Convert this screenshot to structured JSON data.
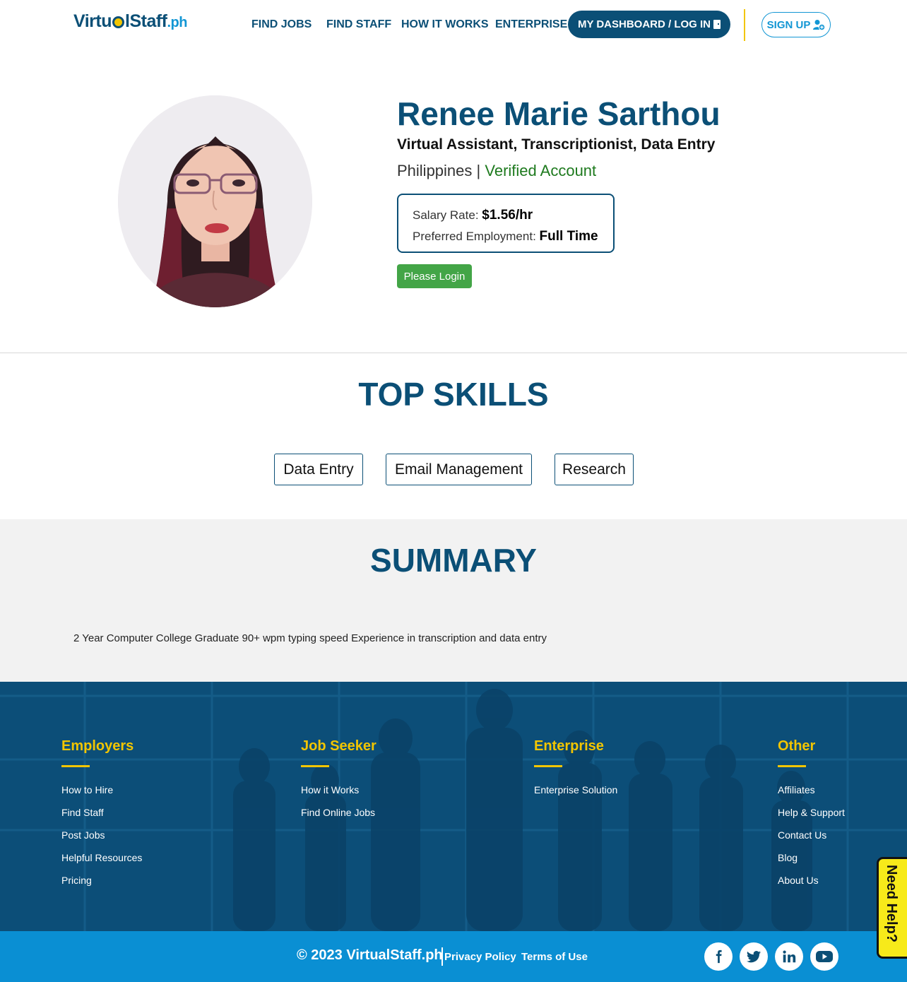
{
  "header": {
    "logo": {
      "part1": "Virtu",
      "part2": "lStaff",
      "part3": ".ph"
    },
    "nav": [
      "FIND JOBS",
      "FIND STAFF",
      "HOW IT WORKS",
      "ENTERPRISE"
    ],
    "dashboard_label": "MY DASHBOARD / LOG IN",
    "signup_label": "SIGN UP"
  },
  "profile": {
    "name": "Renee Marie Sarthou",
    "headline": "Virtual Assistant, Transcriptionist, Data Entry",
    "country": "Philippines",
    "separator": "|",
    "verified": "Verified Account",
    "salary_label": "Salary Rate:",
    "salary_value": "$1.56/hr",
    "employment_label": "Preferred Employment:",
    "employment_value": "Full Time",
    "login_button": "Please Login"
  },
  "skills": {
    "title": "TOP SKILLS",
    "items": [
      "Data Entry",
      "Email Management",
      "Research"
    ]
  },
  "summary": {
    "title": "SUMMARY",
    "text": "2 Year Computer College Graduate 90+ wpm typing speed Experience in transcription and data entry"
  },
  "footer": {
    "columns": [
      {
        "heading": "Employers",
        "links": [
          "How to Hire",
          "Find Staff",
          "Post Jobs",
          "Helpful Resources",
          "Pricing"
        ]
      },
      {
        "heading": "Job Seeker",
        "links": [
          "How it Works",
          "Find Online Jobs"
        ]
      },
      {
        "heading": "Enterprise",
        "links": [
          "Enterprise Solution"
        ]
      },
      {
        "heading": "Other",
        "links": [
          "Affiliates",
          "Help & Support",
          "Contact Us",
          "Blog",
          "About Us"
        ]
      }
    ],
    "copyright": "© 2023 VirtualStaff.ph",
    "privacy": "Privacy Policy",
    "terms": "Terms of Use",
    "social": [
      "facebook-icon",
      "twitter-icon",
      "linkedin-icon",
      "youtube-icon"
    ]
  },
  "help_tab": "Need Help?",
  "colors": {
    "brand_navy": "#0b4f76",
    "brand_blue": "#1296d4",
    "accent_yellow": "#f2c500",
    "verified_green": "#1e7a1e",
    "login_green": "#43a547",
    "bottom_bar": "#0a8fd3"
  }
}
